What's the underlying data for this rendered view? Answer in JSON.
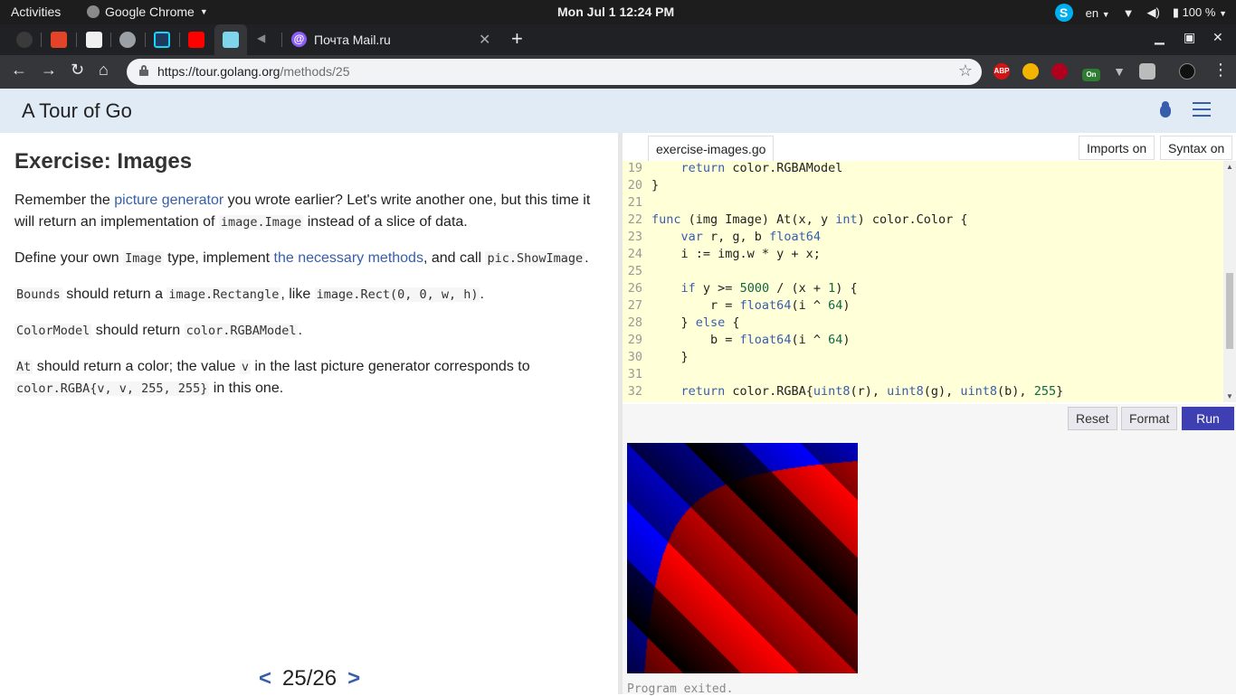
{
  "system_bar": {
    "activities": "Activities",
    "app_name": "Google Chrome",
    "clock": "Mon Jul 1  12:24 PM",
    "language": "en",
    "battery": "100 %"
  },
  "browser": {
    "mail_tab_title": "Почта Mail.ru",
    "url_host": "https://tour.golang.org",
    "url_path": "/methods/25",
    "extensions": [
      "ABP",
      "On"
    ]
  },
  "tour": {
    "site_title": "A Tour of Go",
    "heading": "Exercise: Images",
    "p1_a": "Remember the ",
    "p1_link": "picture generator",
    "p1_b": " you wrote earlier? Let's write another one, but this time it will return an implementation of ",
    "p1_code": "image.Image",
    "p1_c": " instead of a slice of data.",
    "p2_a": "Define your own ",
    "p2_code1": "Image",
    "p2_b": " type, implement ",
    "p2_link": "the necessary methods",
    "p2_c": ", and call ",
    "p2_code2": "pic.ShowImage",
    "p2_d": ".",
    "p3_code1": "Bounds",
    "p3_a": " should return a ",
    "p3_code2": "image.Rectangle",
    "p3_b": ", like ",
    "p3_code3": "image.Rect(0, 0, w, h)",
    "p3_c": ".",
    "p4_code1": "ColorModel",
    "p4_a": " should return ",
    "p4_code2": "color.RGBAModel",
    "p4_b": ".",
    "p5_code1": "At",
    "p5_a": " should return a color; the value ",
    "p5_code2": "v",
    "p5_b": " in the last picture generator corresponds to ",
    "p5_code3": "color.RGBA{v, v, 255, 255}",
    "p5_c": " in this one.",
    "pager_prev": "<",
    "pager_pos": "25/26",
    "pager_next": ">"
  },
  "editor": {
    "file_tab": "exercise-images.go",
    "imports_btn": "Imports on",
    "syntax_btn": "Syntax on",
    "lines": [
      {
        "n": "19",
        "t": "    return color.RGBAModel"
      },
      {
        "n": "20",
        "t": "}"
      },
      {
        "n": "21",
        "t": ""
      },
      {
        "n": "22",
        "t": "func (img Image) At(x, y int) color.Color {"
      },
      {
        "n": "23",
        "t": "    var r, g, b float64"
      },
      {
        "n": "24",
        "t": "    i := img.w * y + x;"
      },
      {
        "n": "25",
        "t": ""
      },
      {
        "n": "26",
        "t": "    if y >= 5000 / (x + 1) {"
      },
      {
        "n": "27",
        "t": "        r = float64(i ^ 64)"
      },
      {
        "n": "28",
        "t": "    } else {"
      },
      {
        "n": "29",
        "t": "        b = float64(i ^ 64)"
      },
      {
        "n": "30",
        "t": "    }"
      },
      {
        "n": "31",
        "t": ""
      },
      {
        "n": "32",
        "t": "    return color.RGBA{uint8(r), uint8(g), uint8(b), 255}"
      }
    ],
    "reset_btn": "Reset",
    "format_btn": "Format",
    "run_btn": "Run",
    "output_text": "Program exited."
  }
}
